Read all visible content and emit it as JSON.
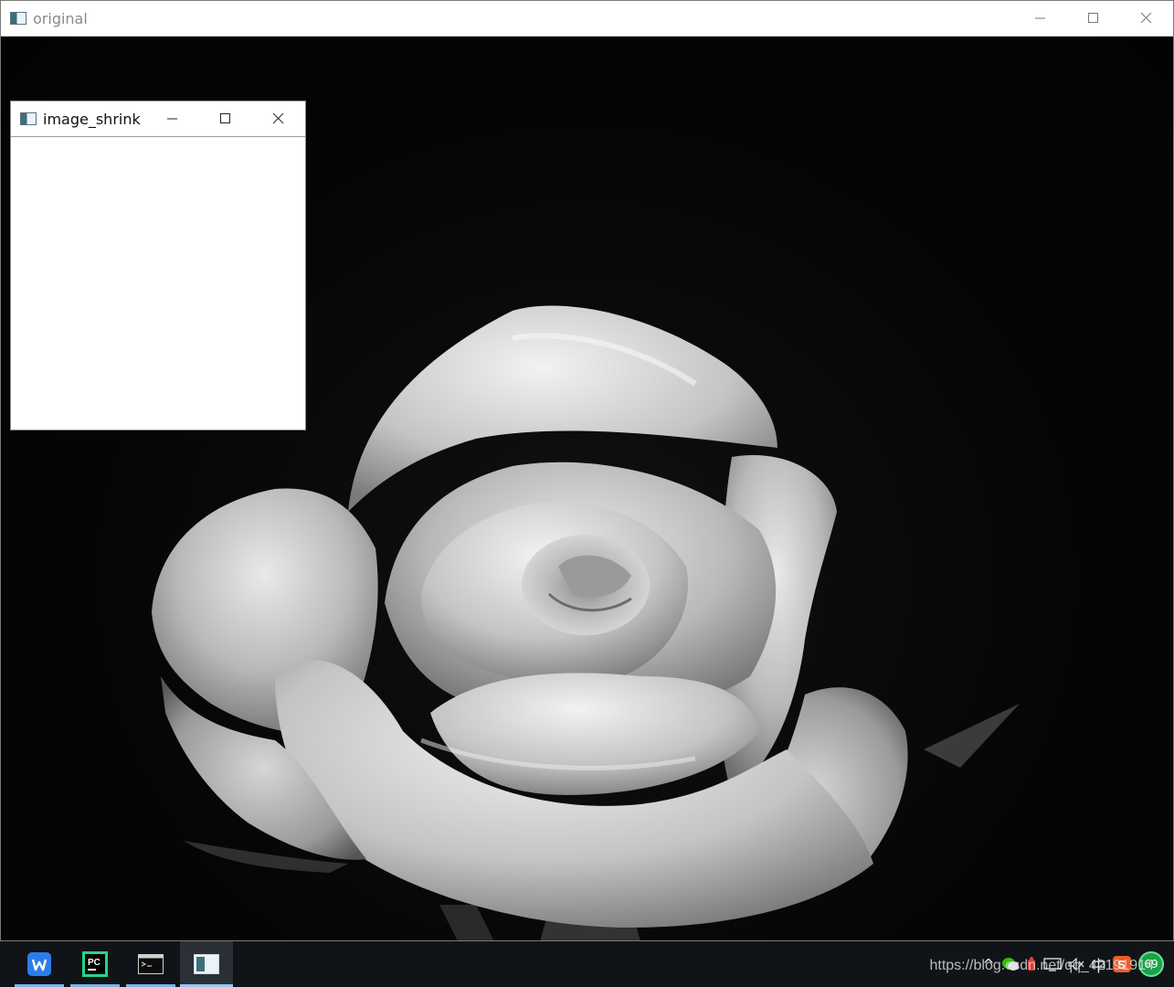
{
  "main_window": {
    "title": "original",
    "controls": {
      "minimize_icon": "minimize-icon",
      "maximize_icon": "maximize-icon",
      "close_icon": "close-icon"
    }
  },
  "child_window": {
    "title": "image_shrink"
  },
  "taskbar": {
    "apps": [
      {
        "name": "wps-office",
        "icon": "wps-icon",
        "glyph": "W",
        "color": "#2b7de9"
      },
      {
        "name": "pycharm",
        "icon": "pycharm-icon",
        "glyph": "PC",
        "color": "#21d789"
      },
      {
        "name": "command-prompt",
        "icon": "terminal-icon",
        "glyph": "C:\\_",
        "color": "#cccccc"
      },
      {
        "name": "opencv-window",
        "icon": "opencv-window-icon",
        "glyph": "",
        "color": "#3a6f7c"
      }
    ],
    "tray": {
      "chevron": "^",
      "ime_label": "中",
      "badge_value": "69"
    }
  },
  "watermark": {
    "text": "https://blog.csdn.net/qq_42191914"
  }
}
